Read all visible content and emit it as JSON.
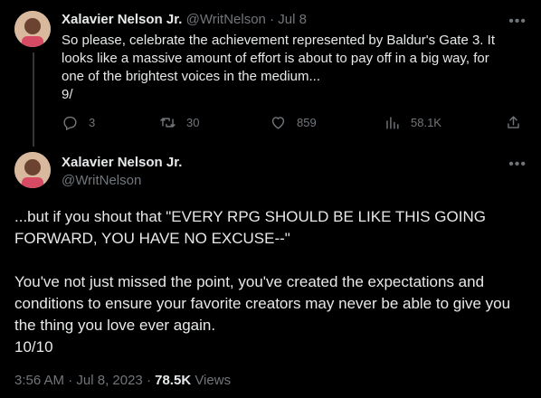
{
  "tweet1": {
    "author_name": "Xalavier Nelson Jr.",
    "author_handle": "@WritNelson",
    "separator": "·",
    "date": "Jul 8",
    "body_lines": [
      "So please, celebrate the achievement represented by Baldur's Gate 3. It",
      "looks like a massive amount of effort is about to pay off in a big way, for",
      "one of the brightest voices in the medium...",
      "9/"
    ],
    "actions": {
      "replies": "3",
      "retweets": "30",
      "likes": "859",
      "views": "58.1K"
    },
    "more_icon": "more-dots-icon"
  },
  "tweet2": {
    "author_name": "Xalavier Nelson Jr.",
    "author_handle": "@WritNelson",
    "para1_lines": [
      "...but if you shout that \"EVERY RPG SHOULD BE LIKE THIS GOING",
      "FORWARD, YOU HAVE NO EXCUSE--\""
    ],
    "para2_lines": [
      "You've not just missed the point, you've created the expectations and",
      "conditions to ensure your favorite creators may never be able to give you",
      "the thing you love ever again.",
      "10/10"
    ],
    "time": "3:56 AM",
    "separator": "·",
    "date": "Jul 8, 2023",
    "views_count": "78.5K",
    "views_label": "Views"
  },
  "colors": {
    "background": "#000000",
    "text": "#e7e9ea",
    "muted": "#71767b",
    "thread_line": "#333639"
  }
}
